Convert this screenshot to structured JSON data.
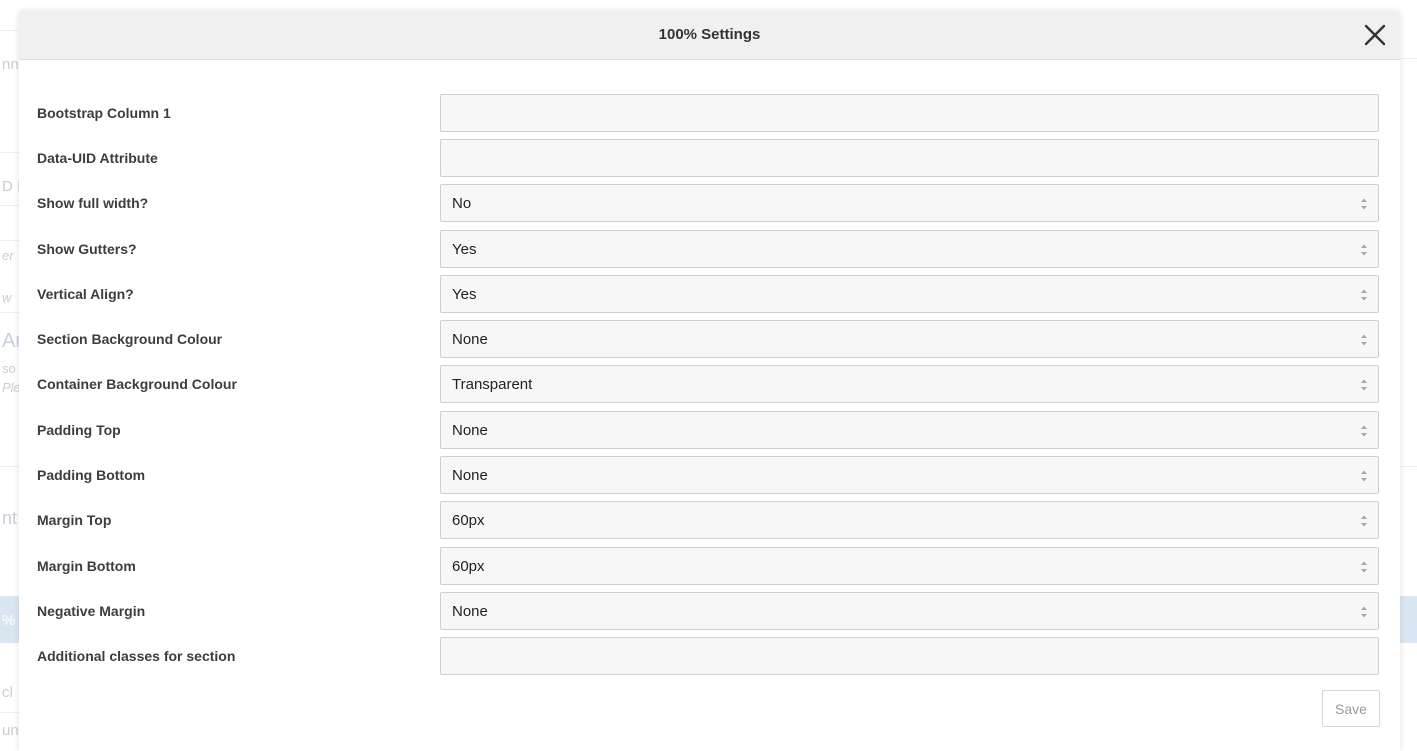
{
  "dialog": {
    "title": "100% Settings",
    "save_label": "Save"
  },
  "fields": [
    {
      "label": "Bootstrap Column 1",
      "type": "text",
      "value": ""
    },
    {
      "label": "Data-UID Attribute",
      "type": "text",
      "value": ""
    },
    {
      "label": "Show full width?",
      "type": "select",
      "value": "No"
    },
    {
      "label": "Show Gutters?",
      "type": "select",
      "value": "Yes"
    },
    {
      "label": "Vertical Align?",
      "type": "select",
      "value": "Yes"
    },
    {
      "label": "Section Background Colour",
      "type": "select",
      "value": "None"
    },
    {
      "label": "Container Background Colour",
      "type": "select",
      "value": "Transparent"
    },
    {
      "label": "Padding Top",
      "type": "select",
      "value": "None"
    },
    {
      "label": "Padding Bottom",
      "type": "select",
      "value": "None"
    },
    {
      "label": "Margin Top",
      "type": "select",
      "value": "60px"
    },
    {
      "label": "Margin Bottom",
      "type": "select",
      "value": "60px"
    },
    {
      "label": "Negative Margin",
      "type": "select",
      "value": "None"
    },
    {
      "label": "Additional classes for section",
      "type": "text",
      "value": ""
    }
  ],
  "background_fragments": [
    "nn",
    "D I",
    "er",
    "w",
    "Ar",
    "so",
    "Ple",
    "nt",
    "%",
    "cl",
    "un"
  ],
  "colors": {
    "header_bg": "#f0f0f0",
    "field_bg": "#f7f7f7",
    "field_border": "#cfcfcf",
    "label_text": "#3d3d3d",
    "background_highlight": "#d9e6f1"
  },
  "icons": {
    "close": "close-icon",
    "select_arrows": "select-arrows-icon"
  }
}
